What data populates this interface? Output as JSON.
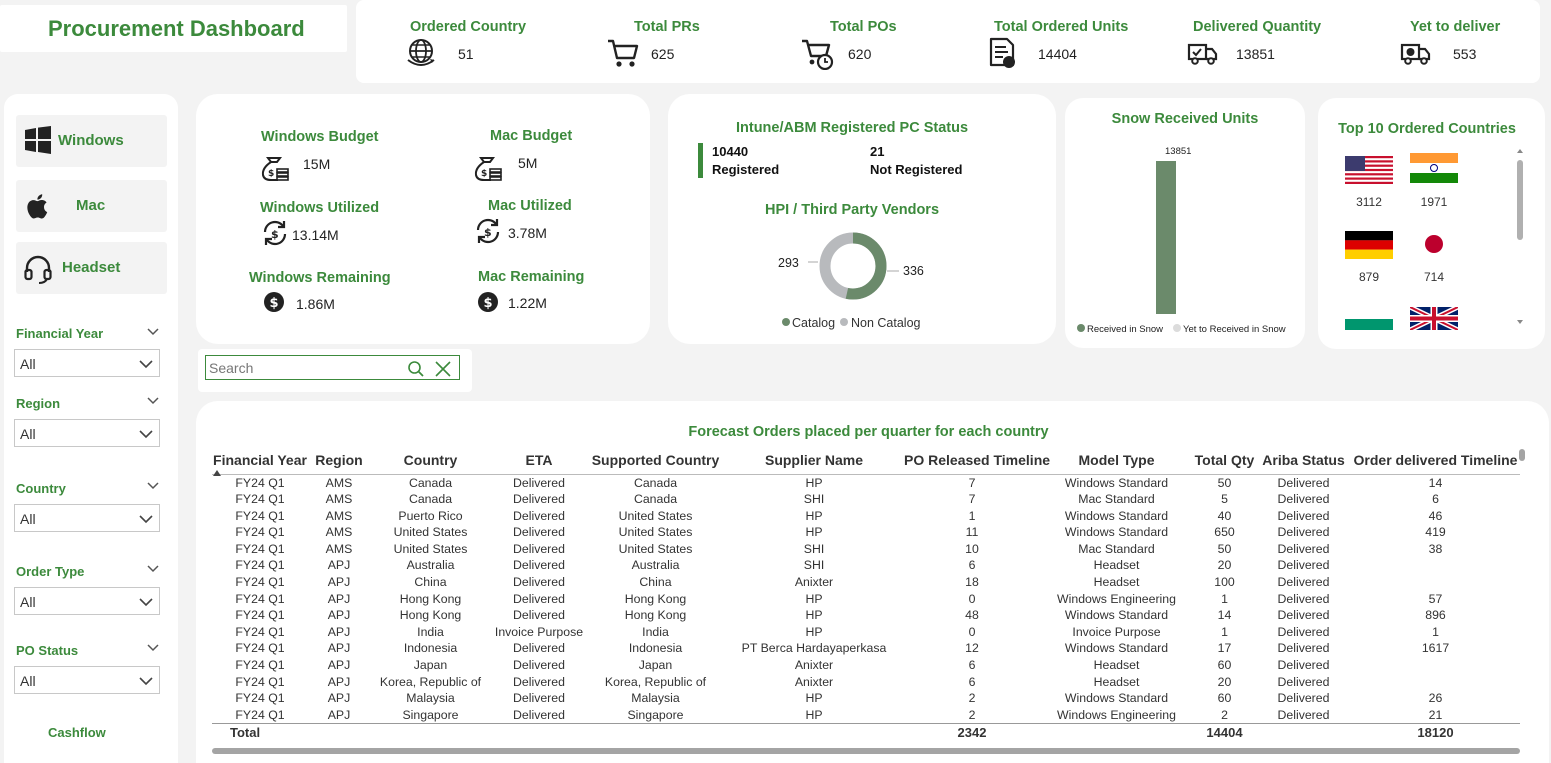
{
  "title": "Procurement Dashboard",
  "kpis": [
    {
      "label": "Ordered Country",
      "value": "51",
      "icon": "globe-icon"
    },
    {
      "label": "Total PRs",
      "value": "625",
      "icon": "cart-icon"
    },
    {
      "label": "Total POs",
      "value": "620",
      "icon": "cart-clock-icon"
    },
    {
      "label": "Total Ordered Units",
      "value": "14404",
      "icon": "document-icon"
    },
    {
      "label": "Delivered Quantity",
      "value": "13851",
      "icon": "truck-check-icon"
    },
    {
      "label": "Yet to deliver",
      "value": "553",
      "icon": "truck-dollar-icon"
    }
  ],
  "nav": {
    "windows": "Windows",
    "mac": "Mac",
    "headset": "Headset"
  },
  "filters": [
    {
      "label": "Financial Year",
      "value": "All"
    },
    {
      "label": "Region",
      "value": "All"
    },
    {
      "label": "Country",
      "value": "All"
    },
    {
      "label": "Order Type",
      "value": "All"
    },
    {
      "label": "PO Status",
      "value": "All"
    }
  ],
  "cashflow": "Cashflow",
  "budget": {
    "windows_budget_label": "Windows Budget",
    "windows_budget": "15M",
    "mac_budget_label": "Mac Budget",
    "mac_budget": "5M",
    "windows_utilized_label": "Windows Utilized",
    "windows_utilized": "13.14M",
    "mac_utilized_label": "Mac Utilized",
    "mac_utilized": "3.78M",
    "windows_remaining_label": "Windows Remaining",
    "windows_remaining": "1.86M",
    "mac_remaining_label": "Mac Remaining",
    "mac_remaining": "1.22M"
  },
  "intune": {
    "title": "Intune/ABM Registered PC Status",
    "registered_value": "10440",
    "registered_label": "Registered",
    "not_registered_value": "21",
    "not_registered_label": "Not Registered"
  },
  "vendors": {
    "title": "HPI / Third Party Vendors",
    "left_value": "293",
    "right_value": "336",
    "legend_catalog": "Catalog",
    "legend_non_catalog": "Non Catalog",
    "colors": {
      "catalog": "#6b8a6b",
      "non_catalog": "#b8babd"
    }
  },
  "snow": {
    "title": "Snow Received Units",
    "value_label": "13851",
    "legend_received": "Received in Snow",
    "legend_yet": "Yet to Received in Snow",
    "colors": {
      "received": "#6b8a6b",
      "yet": "#dcdcdc"
    }
  },
  "chart_data": [
    {
      "type": "pie",
      "title": "HPI / Third Party Vendors",
      "categories": [
        "Catalog",
        "Non Catalog"
      ],
      "values": [
        336,
        293
      ]
    },
    {
      "type": "bar",
      "title": "Snow Received Units",
      "categories": [
        ""
      ],
      "series": [
        {
          "name": "Received in Snow",
          "values": [
            13851
          ]
        },
        {
          "name": "Yet to Received in Snow",
          "values": [
            0
          ]
        }
      ]
    }
  ],
  "top10": {
    "title": "Top 10 Ordered Countries",
    "flags": [
      {
        "icon": "us-flag-icon",
        "value": "3112"
      },
      {
        "icon": "india-flag-icon",
        "value": "1971"
      },
      {
        "icon": "germany-flag-icon",
        "value": "879"
      },
      {
        "icon": "japan-flag-icon",
        "value": "714"
      },
      {
        "icon": "bulgaria-flag-icon",
        "value": ""
      },
      {
        "icon": "uk-flag-icon",
        "value": ""
      }
    ]
  },
  "search": {
    "placeholder": "Search"
  },
  "table": {
    "title": "Forecast Orders placed per quarter for each country",
    "columns": [
      "Financial Year",
      "Region",
      "Country",
      "ETA",
      "Supported Country",
      "Supplier Name",
      "PO Released Timeline",
      "Model Type",
      "Total Qty",
      "Ariba Status",
      "Order delivered Timeline"
    ],
    "rows": [
      [
        "FY24 Q1",
        "AMS",
        "Canada",
        "Delivered",
        "Canada",
        "HP",
        "7",
        "Windows Standard",
        "50",
        "Delivered",
        "14"
      ],
      [
        "FY24 Q1",
        "AMS",
        "Canada",
        "Delivered",
        "Canada",
        "SHI",
        "7",
        "Mac Standard",
        "5",
        "Delivered",
        "6"
      ],
      [
        "FY24 Q1",
        "AMS",
        "Puerto Rico",
        "Delivered",
        "United States",
        "HP",
        "1",
        "Windows Standard",
        "40",
        "Delivered",
        "46"
      ],
      [
        "FY24 Q1",
        "AMS",
        "United States",
        "Delivered",
        "United States",
        "HP",
        "11",
        "Windows Standard",
        "650",
        "Delivered",
        "419"
      ],
      [
        "FY24 Q1",
        "AMS",
        "United States",
        "Delivered",
        "United States",
        "SHI",
        "10",
        "Mac Standard",
        "50",
        "Delivered",
        "38"
      ],
      [
        "FY24 Q1",
        "APJ",
        "Australia",
        "Delivered",
        "Australia",
        "SHI",
        "6",
        "Headset",
        "20",
        "Delivered",
        ""
      ],
      [
        "FY24 Q1",
        "APJ",
        "China",
        "Delivered",
        "China",
        "Anixter",
        "18",
        "Headset",
        "100",
        "Delivered",
        ""
      ],
      [
        "FY24 Q1",
        "APJ",
        "Hong Kong",
        "Delivered",
        "Hong Kong",
        "HP",
        "0",
        "Windows Engineering",
        "1",
        "Delivered",
        "57"
      ],
      [
        "FY24 Q1",
        "APJ",
        "Hong Kong",
        "Delivered",
        "Hong Kong",
        "HP",
        "48",
        "Windows Standard",
        "14",
        "Delivered",
        "896"
      ],
      [
        "FY24 Q1",
        "APJ",
        "India",
        "Invoice Purpose",
        "India",
        "HP",
        "0",
        "Invoice Purpose",
        "1",
        "Delivered",
        "1"
      ],
      [
        "FY24 Q1",
        "APJ",
        "Indonesia",
        "Delivered",
        "Indonesia",
        "PT Berca Hardayaperkasa",
        "12",
        "Windows Standard",
        "17",
        "Delivered",
        "1617"
      ],
      [
        "FY24 Q1",
        "APJ",
        "Japan",
        "Delivered",
        "Japan",
        "Anixter",
        "6",
        "Headset",
        "60",
        "Delivered",
        ""
      ],
      [
        "FY24 Q1",
        "APJ",
        "Korea, Republic of",
        "Delivered",
        "Korea, Republic of",
        "Anixter",
        "6",
        "Headset",
        "20",
        "Delivered",
        ""
      ],
      [
        "FY24 Q1",
        "APJ",
        "Malaysia",
        "Delivered",
        "Malaysia",
        "HP",
        "2",
        "Windows Standard",
        "60",
        "Delivered",
        "26"
      ],
      [
        "FY24 Q1",
        "APJ",
        "Singapore",
        "Delivered",
        "Singapore",
        "HP",
        "2",
        "Windows Engineering",
        "2",
        "Delivered",
        "21"
      ]
    ],
    "total": [
      "Total",
      "",
      "",
      "",
      "",
      "",
      "2342",
      "",
      "14404",
      "",
      "18120"
    ]
  },
  "colors": {
    "accent": "#3c8a3c",
    "background": "#f3f3f3"
  }
}
